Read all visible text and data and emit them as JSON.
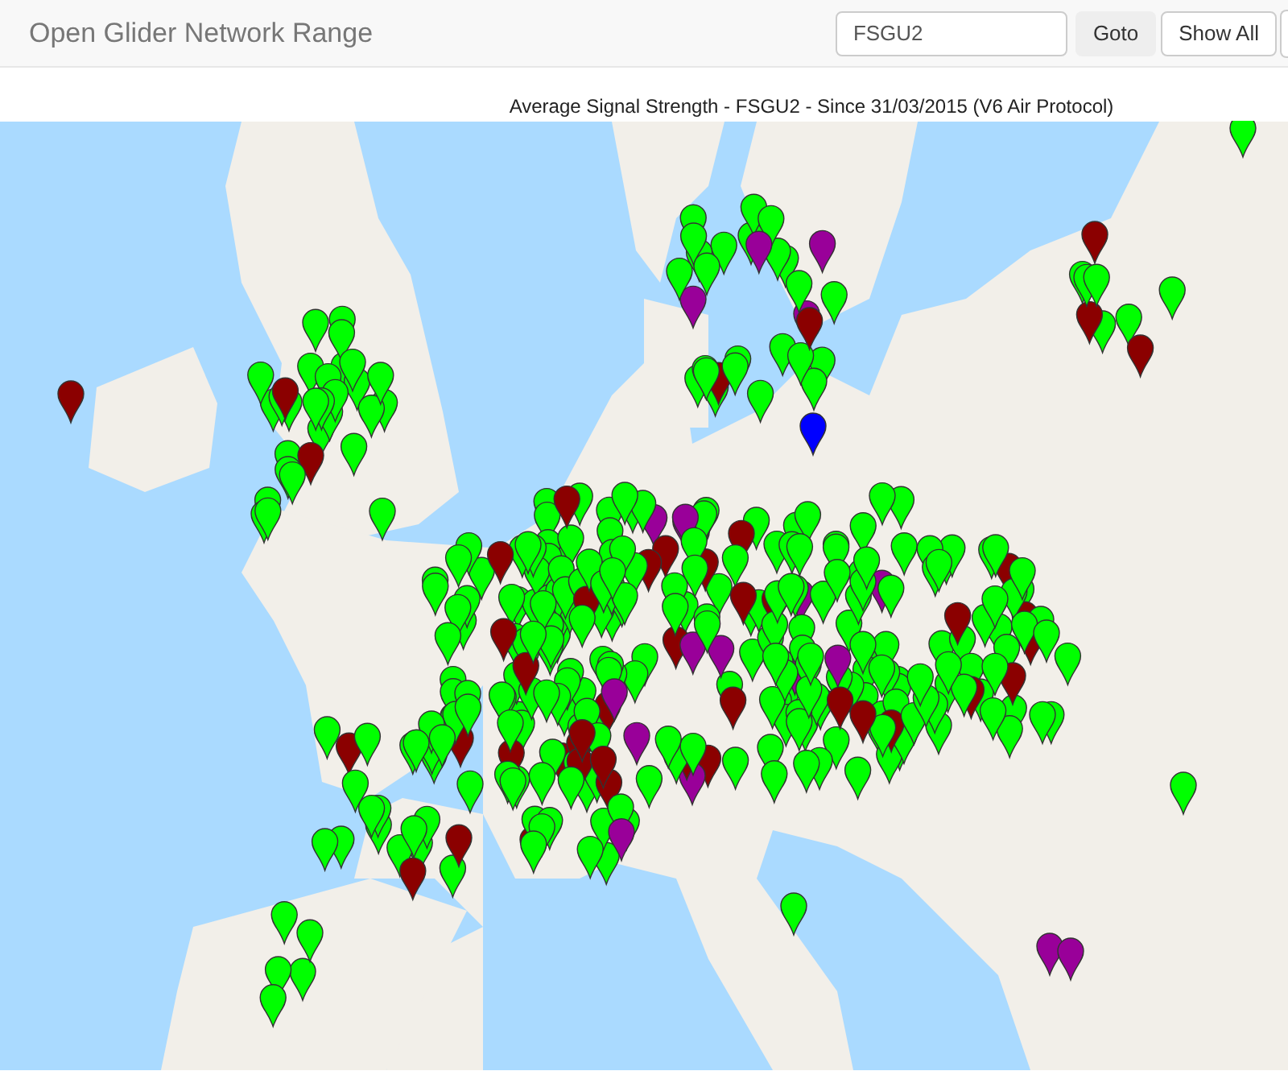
{
  "navbar": {
    "title": "Open Glider Network Range",
    "search": {
      "value": "FSGU2"
    },
    "buttons": [
      "Goto",
      "Show All"
    ]
  },
  "map": {
    "title": "Average Signal Strength - FSGU2 - Since 31/03/2015 (V6 Air Protocol)"
  }
}
